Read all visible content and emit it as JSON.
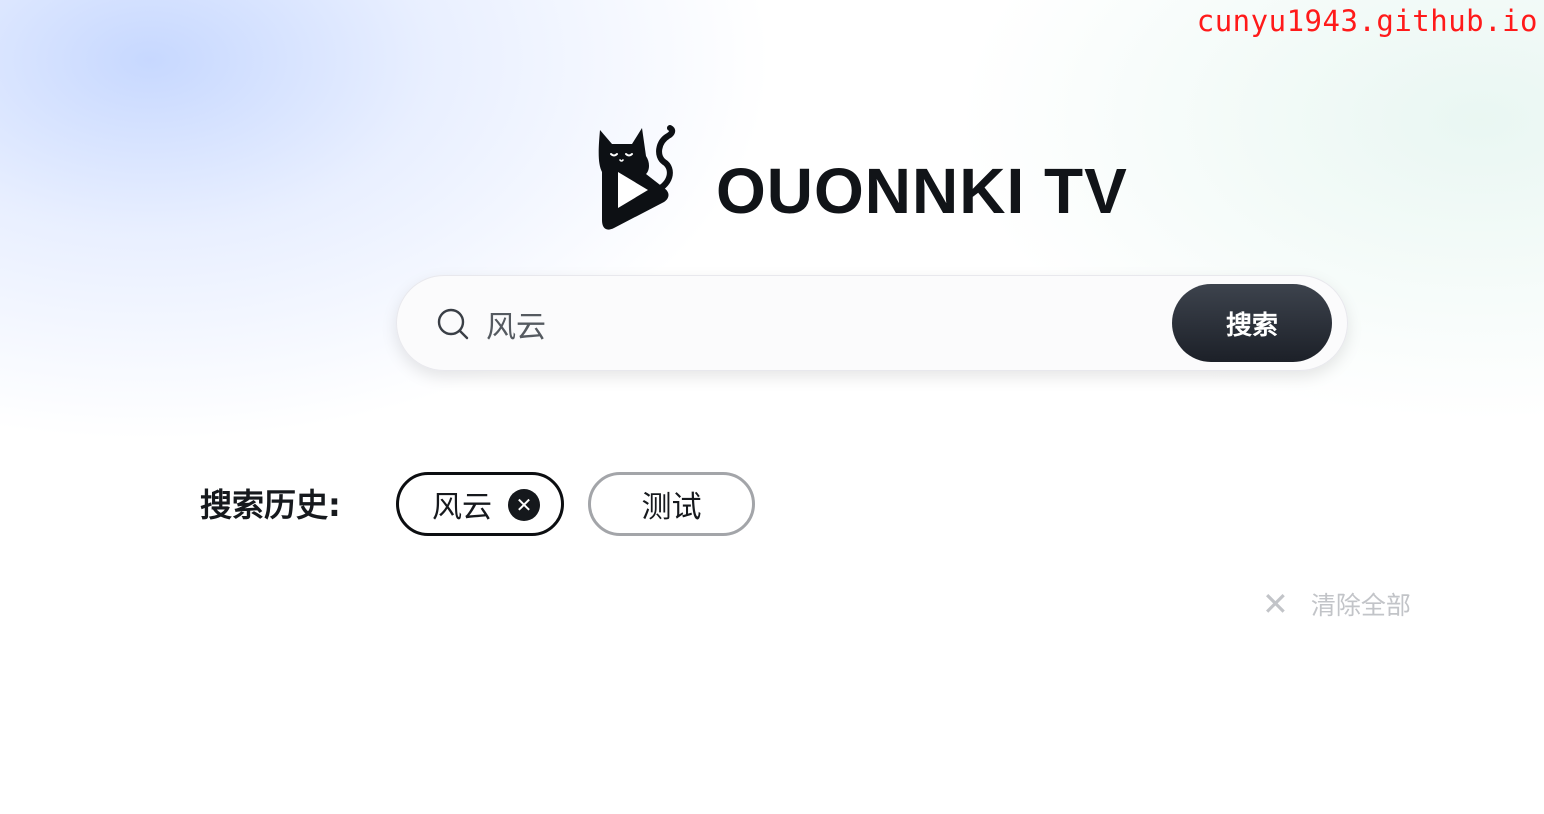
{
  "watermark": "cunyu1943.github.io",
  "brand": {
    "title": "OUONNKI TV",
    "logo_icon": "cat-play-logo-icon"
  },
  "search": {
    "icon": "search-icon",
    "value": "风云",
    "button_label": "搜索"
  },
  "history": {
    "label": "搜索历史:",
    "items": [
      {
        "label": "风云",
        "close_icon": "close-icon",
        "active": true
      },
      {
        "label": "测试",
        "active": false
      }
    ],
    "clear_all_label": "清除全部",
    "clear_all_icon": "x-icon"
  },
  "colors": {
    "watermark": "#ff1a1a",
    "button_dark": "#1c2028",
    "text_dark": "#16191d",
    "muted": "#c2c4c8"
  }
}
